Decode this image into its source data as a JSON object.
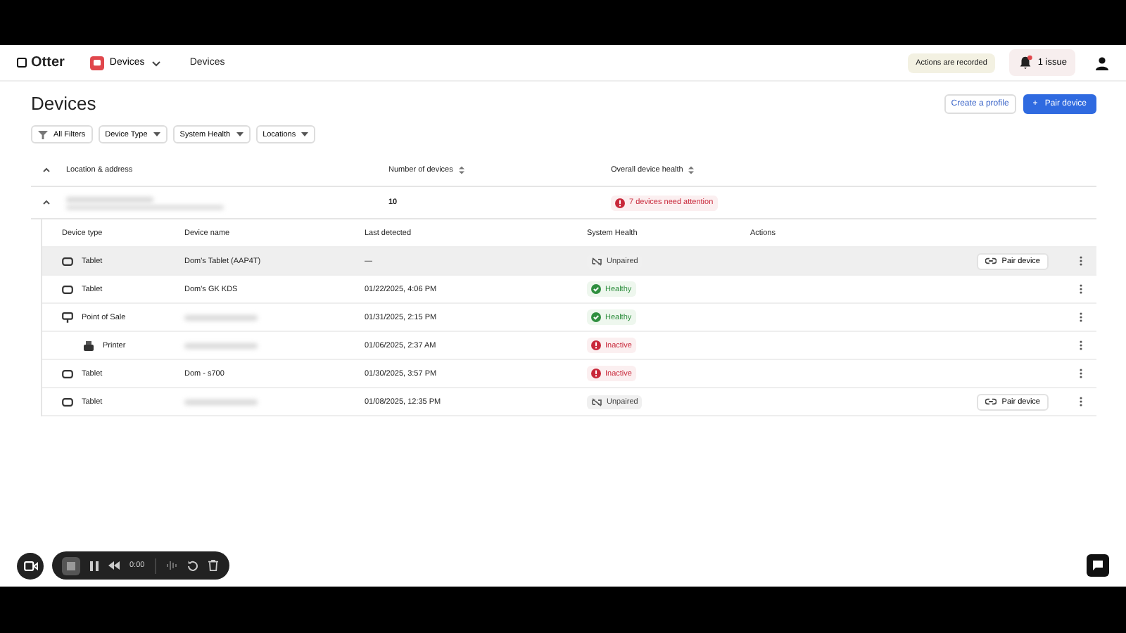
{
  "topbar": {
    "logo": "Otter",
    "app_menu": "Devices",
    "breadcrumb": "Devices",
    "recording_badge": "Actions are recorded",
    "issues": "1 issue"
  },
  "page": {
    "title": "Devices",
    "buttons": [
      {
        "label": "Create a profile",
        "kind": "secondary"
      },
      {
        "label": "Pair device",
        "kind": "primary",
        "icon": "+"
      }
    ]
  },
  "filters": [
    {
      "label": "All Filters",
      "kind": "all"
    },
    {
      "label": "Device Type",
      "kind": "dropdown"
    },
    {
      "label": "System Health",
      "kind": "dropdown"
    },
    {
      "label": "Locations",
      "kind": "dropdown"
    }
  ],
  "table": {
    "columns": [
      "Location & address",
      "Number of devices",
      "Overall device health"
    ],
    "group": {
      "expanded": true,
      "location_redacted": true,
      "count": "10",
      "health": "7 devices need attention"
    },
    "sub_columns": [
      "Device type",
      "Device name",
      "Last detected",
      "System Health",
      "Actions"
    ],
    "rows": [
      {
        "kind": "tablet",
        "type": "Tablet",
        "name": "Dom's Tablet (AAP4T)",
        "name_redacted": false,
        "last": "—",
        "health": {
          "kind": "unpaired",
          "label": "Unpaired"
        },
        "action": "Pair device",
        "hovered": true
      },
      {
        "kind": "tablet",
        "type": "Tablet",
        "name": "Dom's GK KDS",
        "name_redacted": false,
        "last": "01/22/2025, 4:06 PM",
        "health": {
          "kind": "healthy",
          "label": "Healthy"
        },
        "hovered": false
      },
      {
        "kind": "pos",
        "type": "Point of Sale",
        "name_redacted": true,
        "last": "01/31/2025, 2:15 PM",
        "health": {
          "kind": "healthy",
          "label": "Healthy"
        },
        "hovered": false,
        "children": [
          {
            "kind": "printer",
            "type": "Printer",
            "name_redacted": true,
            "last": "01/06/2025, 2:37 AM",
            "health": {
              "kind": "inactive",
              "label": "Inactive"
            },
            "hovered": false
          }
        ]
      },
      {
        "kind": "tablet",
        "type": "Tablet",
        "name": "Dom - s700",
        "name_redacted": false,
        "last": "01/30/2025, 3:57 PM",
        "health": {
          "kind": "inactive",
          "label": "Inactive"
        },
        "hovered": false
      },
      {
        "kind": "tablet",
        "type": "Tablet",
        "name_redacted": true,
        "last": "01/08/2025, 12:35 PM",
        "health": {
          "kind": "unpaired",
          "label": "Unpaired"
        },
        "action": "Pair device",
        "hovered": false
      }
    ]
  },
  "recorder": {
    "time": "0:00"
  }
}
